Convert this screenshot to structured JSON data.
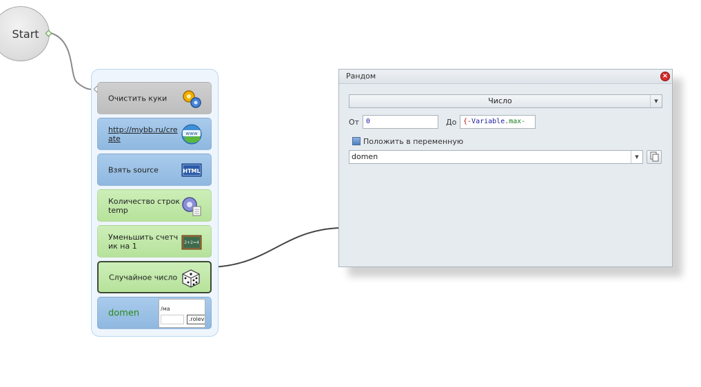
{
  "canvas": {
    "start_label": "Start"
  },
  "blocks": [
    {
      "label": "Очистить куки",
      "icon": "gears-icon"
    },
    {
      "label": "http://mybb.ru/create",
      "icon": "www-globe-icon"
    },
    {
      "label": "Взять source",
      "icon": "html-icon"
    },
    {
      "label": "Количество строк temp",
      "icon": "gear-document-icon"
    },
    {
      "label": "Уменьшить счетчик на 1",
      "icon": "chalkboard-icon"
    },
    {
      "label": "Случайное число",
      "icon": "dice-icon"
    },
    {
      "label": "domen",
      "icon": "preview-thumbnail"
    }
  ],
  "thumb": {
    "text1": "/ма",
    "text2": ".rolev"
  },
  "panel": {
    "title": "Рандом",
    "type_value": "Число",
    "from_label": "От",
    "from_value": "0",
    "to_label": "До",
    "to_value_brace_open": "{-",
    "to_value_var": "Variable",
    "to_value_dot": ".",
    "to_value_name": "max-",
    "save_label": "Положить в переменную",
    "variable_value": "domen"
  },
  "colors": {
    "block_gray": "#c6c6c6",
    "block_blue": "#9cc2e6",
    "block_green": "#c1e8a8",
    "panel_bg": "#e6ebf0",
    "close_red": "#d62b2b"
  }
}
